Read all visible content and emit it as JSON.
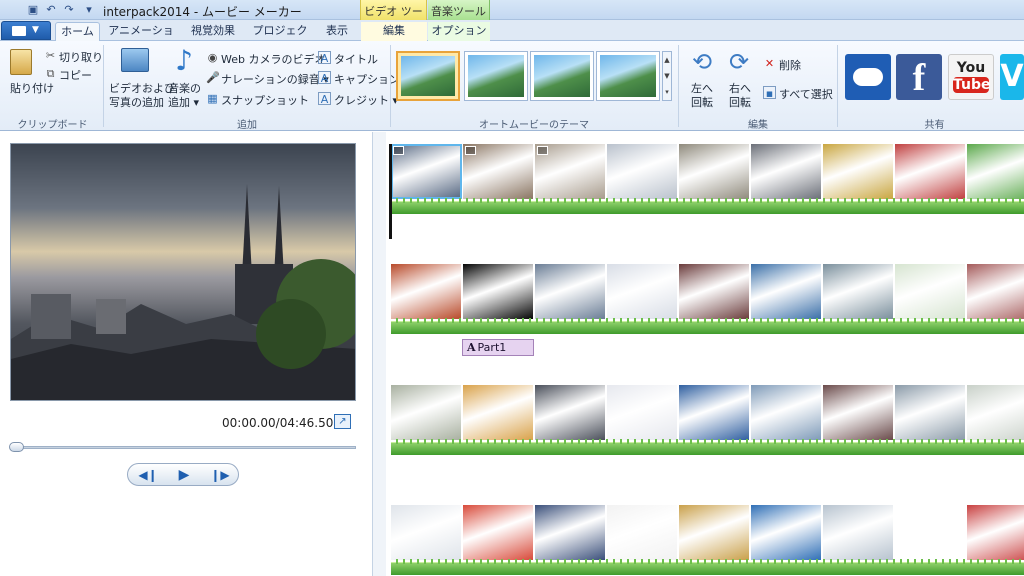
{
  "window": {
    "title": "interpack2014 - ムービー メーカー"
  },
  "context_tabs": {
    "video_tools": "ビデオ ツール",
    "music_tools": "音楽ツール"
  },
  "tabs": [
    {
      "label": "ホーム",
      "active": true
    },
    {
      "label": "アニメーション"
    },
    {
      "label": "視覚効果"
    },
    {
      "label": "プロジェクト"
    },
    {
      "label": "表示"
    },
    {
      "label": "編集"
    },
    {
      "label": "オプション"
    }
  ],
  "ribbon": {
    "clipboard": {
      "paste": "貼り付け",
      "cut": "切り取り",
      "copy": "コピー",
      "group": "クリップボード"
    },
    "add": {
      "add_video_photo_1": "ビデオおよび",
      "add_video_photo_2": "写真の追加",
      "add_music_1": "音楽の",
      "add_music_2": "追加 ▾",
      "webcam": "Web カメラのビデオ",
      "narration": "ナレーションの録音 ▾",
      "snapshot": "スナップショット",
      "title": "タイトル",
      "caption": "キャプション",
      "credit": "クレジット ▾",
      "group": "追加"
    },
    "themes": {
      "group": "オートムービーのテーマ"
    },
    "edit": {
      "rotate_left_1": "左へ",
      "rotate_left_2": "回転",
      "rotate_right_1": "右へ",
      "rotate_right_2": "回転",
      "delete": "削除",
      "select_all": "すべて選択",
      "group": "編集"
    },
    "share": {
      "group": "共有",
      "facebook": "f",
      "youtube_1": "You",
      "youtube_2": "Tube",
      "vimeo": "V"
    }
  },
  "player": {
    "time": "00:00.00/04:46.50",
    "position_fraction": 0.0
  },
  "storyboard": {
    "caption": "Part1"
  },
  "colors": {
    "accent": "#2f6fb6",
    "grass": "#3f9b2c",
    "selected_theme": "#e8a33a"
  }
}
